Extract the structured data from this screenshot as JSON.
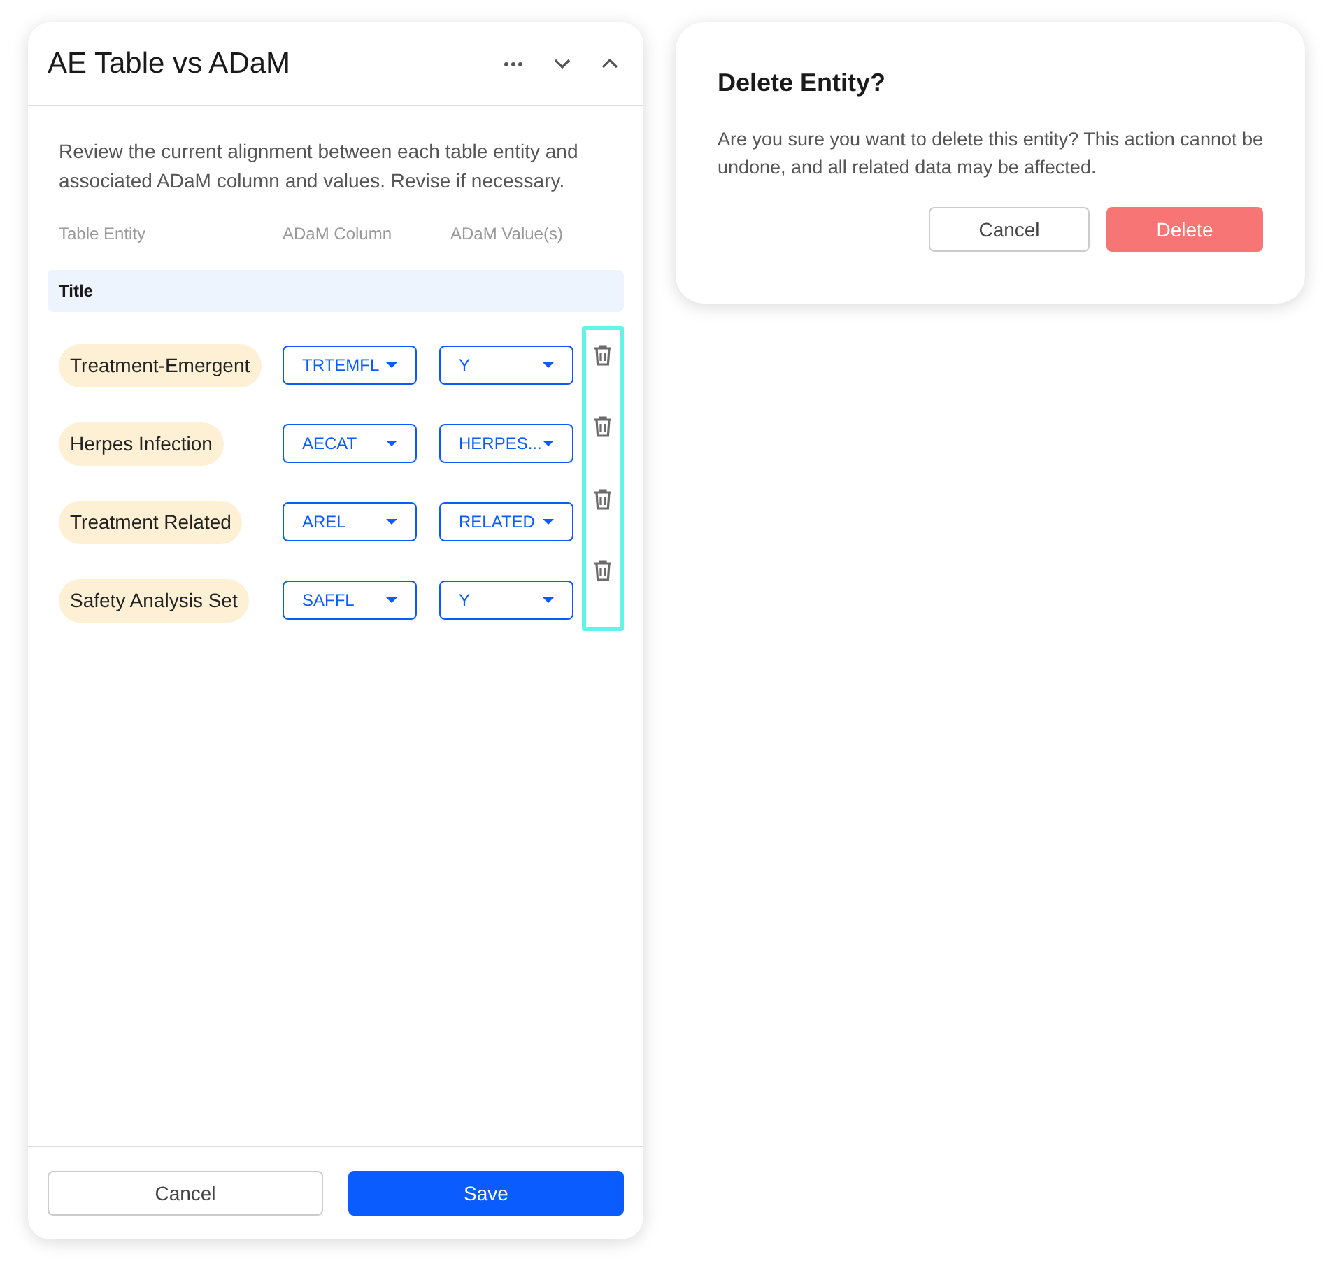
{
  "panel": {
    "title": "AE Table vs ADaM",
    "description": "Review the current alignment between each table entity and associated ADaM column and values. Revise if necessary.",
    "columns": [
      "Table Entity",
      "ADaM Column",
      "ADaM Value(s)"
    ],
    "section": "Title",
    "rows": [
      {
        "entity": "Treatment-Emergent",
        "column": "TRTEMFL",
        "value": "Y"
      },
      {
        "entity": "Herpes Infection",
        "column": "AECAT",
        "value": "HERPES..."
      },
      {
        "entity": "Treatment Related",
        "column": "AREL",
        "value": "RELATED"
      },
      {
        "entity": "Safety Analysis Set",
        "column": "SAFFL",
        "value": "Y"
      }
    ],
    "delete_column_highlighted": true,
    "buttons": {
      "cancel": "Cancel",
      "save": "Save"
    }
  },
  "dialog": {
    "title": "Delete Entity?",
    "message": "Are you sure you want to delete this entity? This action cannot be undone, and all related data may be affected.",
    "buttons": {
      "cancel": "Cancel",
      "delete": "Delete"
    }
  }
}
